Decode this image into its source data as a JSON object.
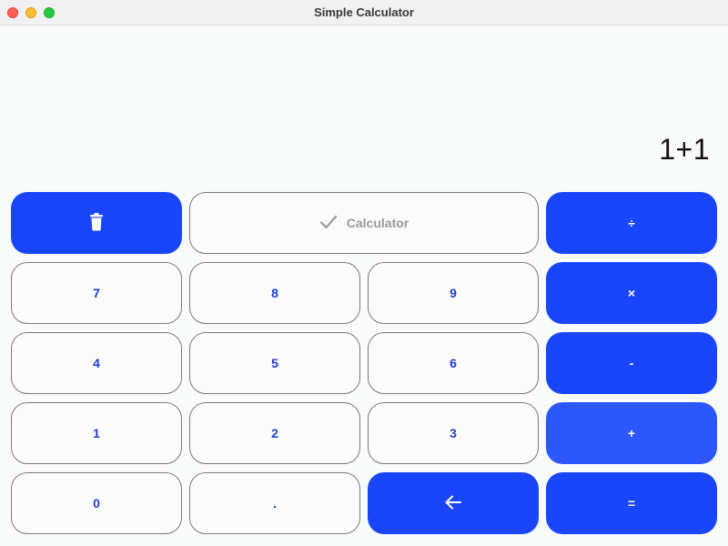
{
  "window": {
    "title": "Simple Calculator",
    "traffic_lights": [
      "close",
      "minimize",
      "zoom"
    ]
  },
  "display": {
    "value": "1+1"
  },
  "buttons": {
    "trash": {
      "icon": "trash-icon"
    },
    "calculator": {
      "label": "Calculator",
      "icon": "checkmark-icon"
    },
    "divide": "÷",
    "multiply": "×",
    "subtract": "-",
    "add": "+",
    "equals": "=",
    "backspace": {
      "icon": "arrow-left-icon"
    },
    "seven": "7",
    "eight": "8",
    "nine": "9",
    "four": "4",
    "five": "5",
    "six": "6",
    "one": "1",
    "two": "2",
    "three": "3",
    "zero": "0",
    "decimal": "."
  },
  "colors": {
    "accent": "#1946fb",
    "accent_hover": "#2c58fb",
    "digit_text": "#1e3fd0",
    "background": "#f9fbfa"
  }
}
